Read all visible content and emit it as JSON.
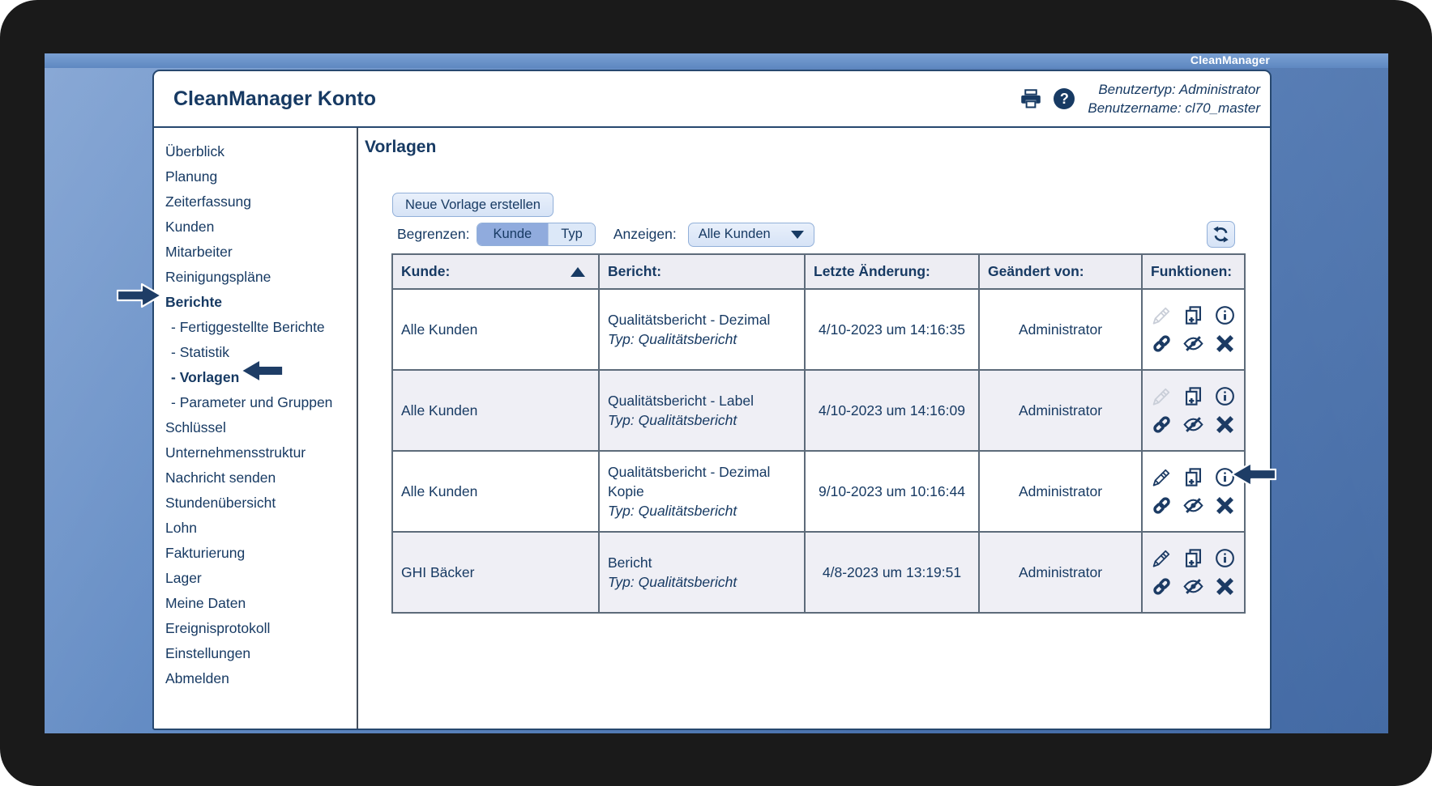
{
  "titlebar": {
    "brand": "CleanManager"
  },
  "header": {
    "title": "CleanManager Konto",
    "user_type": "Benutzertyp: Administrator",
    "user_name": "Benutzername: cl70_master",
    "icons": [
      "print-icon",
      "help-icon"
    ]
  },
  "sidebar": {
    "items": [
      {
        "label": "Überblick"
      },
      {
        "label": "Planung"
      },
      {
        "label": "Zeiterfassung"
      },
      {
        "label": "Kunden"
      },
      {
        "label": "Mitarbeiter"
      },
      {
        "label": "Reinigungspläne"
      },
      {
        "label": "Berichte",
        "bold": true
      },
      {
        "label": "- Fertiggestellte Berichte",
        "sub": true
      },
      {
        "label": "- Statistik",
        "sub": true
      },
      {
        "label": "- Vorlagen",
        "sub": true,
        "bold": true
      },
      {
        "label": "- Parameter und Gruppen",
        "sub": true
      },
      {
        "label": "Schlüssel"
      },
      {
        "label": "Unternehmensstruktur"
      },
      {
        "label": "Nachricht senden"
      },
      {
        "label": "Stundenübersicht"
      },
      {
        "label": "Lohn"
      },
      {
        "label": "Fakturierung"
      },
      {
        "label": "Lager"
      },
      {
        "label": "Meine Daten"
      },
      {
        "label": "Ereignisprotokoll"
      },
      {
        "label": "Einstellungen"
      },
      {
        "label": "Abmelden"
      }
    ]
  },
  "main": {
    "heading": "Vorlagen",
    "toolbar": {
      "create_button": "Neue Vorlage erstellen",
      "limit_label": "Begrenzen:",
      "limit_options": [
        {
          "label": "Kunde",
          "selected": true
        },
        {
          "label": "Typ",
          "selected": false
        }
      ],
      "show_label": "Anzeigen:",
      "show_value": "Alle Kunden"
    },
    "table": {
      "columns": [
        "Kunde:",
        "Bericht:",
        "Letzte Änderung:",
        "Geändert von:",
        "Funktionen:"
      ],
      "sort": {
        "column": "Kunde:",
        "direction": "ascending"
      },
      "function_icons": [
        "edit-icon",
        "duplicate-icon",
        "info-icon",
        "link-icon",
        "hide-icon",
        "delete-icon"
      ],
      "rows": [
        {
          "kunde": "Alle Kunden",
          "bericht": "Qualitätsbericht - Dezimal",
          "typ": "Typ: Qualitätsbericht",
          "modified": "4/10-2023 um 14:16:35",
          "modified_by": "Administrator",
          "edit_enabled": false
        },
        {
          "kunde": "Alle Kunden",
          "bericht": "Qualitätsbericht - Label",
          "typ": "Typ: Qualitätsbericht",
          "modified": "4/10-2023 um 14:16:09",
          "modified_by": "Administrator",
          "edit_enabled": false
        },
        {
          "kunde": "Alle Kunden",
          "bericht": "Qualitätsbericht - Dezimal Kopie",
          "typ": "Typ: Qualitätsbericht",
          "modified": "9/10-2023 um 10:16:44",
          "modified_by": "Administrator",
          "edit_enabled": true
        },
        {
          "kunde": "GHI Bäcker",
          "bericht": "Bericht",
          "typ": "Typ: Qualitätsbericht",
          "modified": "4/8-2023 um 13:19:51",
          "modified_by": "Administrator",
          "edit_enabled": true
        }
      ]
    }
  },
  "annotations": {
    "arrows": [
      {
        "target": "sidebar-item-berichte",
        "direction": "right"
      },
      {
        "target": "sidebar-item-vorlagen",
        "direction": "left"
      },
      {
        "target": "row-3-info-icon",
        "direction": "left"
      }
    ]
  },
  "colors": {
    "navy_text": "#173a63",
    "desktop_blue": "#5b85bf",
    "accent_selected": "#90abdd",
    "control_bg": "#dce8f8",
    "control_border": "#92b0d9",
    "table_border": "#5d6b7a",
    "header_row_bg": "#ededf3",
    "alt_row_bg": "#efeff5",
    "disabled_icon": "#c9ced8",
    "arrow_fill": "#1e3d66"
  }
}
